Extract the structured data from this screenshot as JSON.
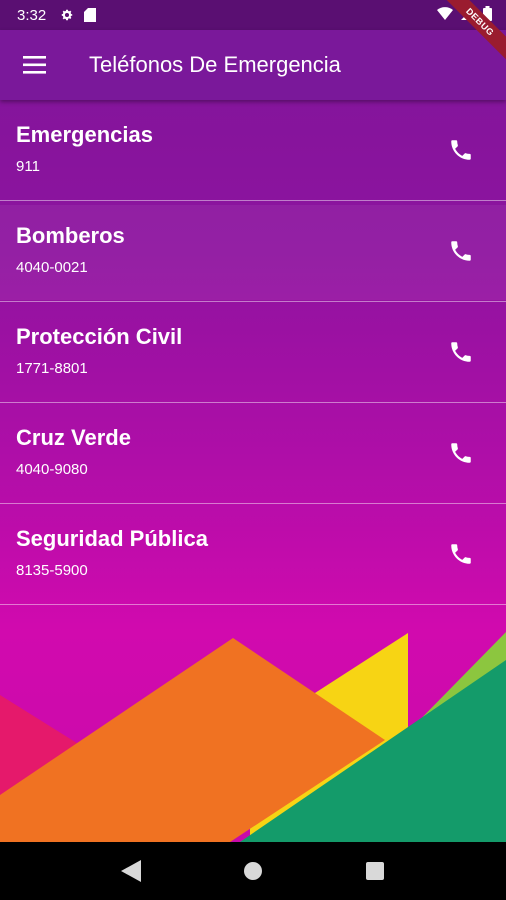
{
  "status_bar": {
    "time": "3:32",
    "icons": [
      "gear-icon",
      "sd-card-icon",
      "wifi-icon",
      "signal-icon",
      "battery-icon"
    ]
  },
  "debug_banner": "DEBUG",
  "app_bar": {
    "title": "Teléfonos De Emergencia",
    "menu_icon": "hamburger-menu-icon"
  },
  "contacts": [
    {
      "name": "Emergencias",
      "number": "911",
      "icon": "phone-icon"
    },
    {
      "name": "Bomberos",
      "number": "4040-0021",
      "icon": "phone-icon"
    },
    {
      "name": "Protección Civil",
      "number": "1771-8801",
      "icon": "phone-icon"
    },
    {
      "name": "Cruz Verde",
      "number": "4040-9080",
      "icon": "phone-icon"
    },
    {
      "name": "Seguridad Pública",
      "number": "8135-5900",
      "icon": "phone-icon"
    }
  ],
  "nav_bar": {
    "buttons": [
      "back-icon",
      "home-icon",
      "recents-icon"
    ]
  },
  "colors": {
    "app_bar": "#7a189a",
    "status_bar": "#5a0f72",
    "background_top": "#7e1699",
    "background_bottom": "#d10aae",
    "mountain_orange": "#f07222",
    "mountain_yellow": "#f7d414",
    "mountain_green": "#149b6a",
    "mountain_lime": "#8cc63f",
    "mountain_red": "#e5196b"
  }
}
